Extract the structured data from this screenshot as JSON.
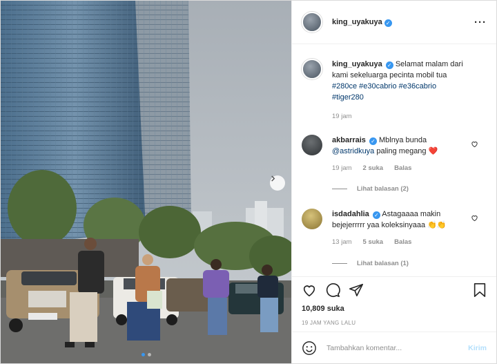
{
  "post": {
    "author": "king_uyakuya",
    "verified": true,
    "caption": "Selamat malam dari kami sekeluarga pecinta mobil tua",
    "hashtags": [
      "#280ce",
      "#e30cabrio",
      "#e36cabrio",
      "#tiger280"
    ],
    "caption_time": "19 jam",
    "likes": "10,809 suka",
    "posted": "19 JAM YANG LALU",
    "carousel": {
      "total": 2,
      "current": 1
    }
  },
  "comments": [
    {
      "user": "akbarrais",
      "verified": true,
      "text": "Mblnya bunda",
      "mention": "@astridkuya",
      "text2": "paling megang",
      "emoji": "❤️",
      "time": "19 jam",
      "likes": "2 suka",
      "reply_label": "Balas",
      "view_replies": "Lihat balasan (2)"
    },
    {
      "user": "isdadahlia",
      "verified": true,
      "text": "Astagaaaa makin bejejerrrrr yaa koleksinyaaa",
      "emoji": "👏👏",
      "time": "13 jam",
      "likes": "5 suka",
      "reply_label": "Balas",
      "view_replies": "Lihat balasan (1)"
    }
  ],
  "composer": {
    "placeholder": "Tambahkan komentar...",
    "post_label": "Kirim"
  },
  "icons": {
    "more": "more-options-icon",
    "like": "heart-icon",
    "comment": "comment-icon",
    "share": "send-icon",
    "save": "bookmark-icon",
    "emoji": "emoji-icon",
    "next": "chevron-right-icon"
  },
  "colors": {
    "link": "#00376b",
    "verified": "#3897f0",
    "heart": "#ed4956",
    "post_button": "#b2dffc"
  }
}
